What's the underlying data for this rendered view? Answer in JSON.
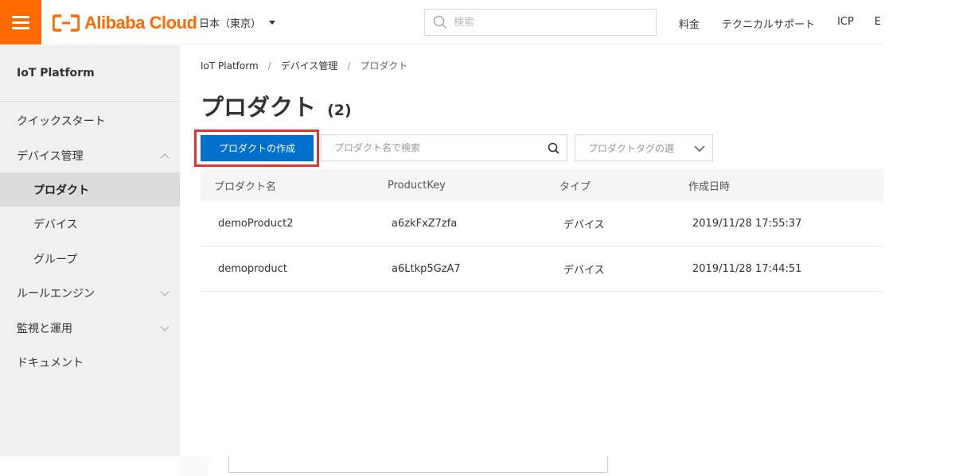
{
  "header": {
    "brand_name": "Alibaba Cloud",
    "brand_color": "#ff6a00",
    "region": "日本（東京）",
    "search_placeholder": "検索",
    "nav": [
      "料金",
      "テクニカルサポート",
      "ICP",
      "E"
    ]
  },
  "sidebar": {
    "title": "IoT Platform",
    "items": [
      {
        "label": "クイックスタート",
        "level": 1,
        "icon": ""
      },
      {
        "label": "デバイス管理",
        "level": 1,
        "icon": "chevron-up-icon"
      },
      {
        "label": "プロダクト",
        "level": 2,
        "active": true
      },
      {
        "label": "デバイス",
        "level": 2
      },
      {
        "label": "グループ",
        "level": 2
      },
      {
        "label": "ルールエンジン",
        "level": 1,
        "icon": "chevron-down-icon"
      },
      {
        "label": "監視と運用",
        "level": 1,
        "icon": "chevron-down-icon"
      },
      {
        "label": "ドキュメント",
        "level": 1,
        "icon": ""
      }
    ]
  },
  "breadcrumb": [
    "IoT Platform",
    "デバイス管理",
    "プロダクト"
  ],
  "page": {
    "title": "プロダクト",
    "count": "(2)"
  },
  "toolbar": {
    "create_button": "プロダクトの作成",
    "create_button_color": "#0070cc",
    "highlight_color": "#e5342f",
    "search_placeholder": "プロダクト名で検索",
    "tag_select_placeholder": "プロダクトタグの選"
  },
  "table": {
    "columns": [
      "プロダクト名",
      "ProductKey",
      "タイプ",
      "作成日時"
    ],
    "rows": [
      [
        "demoProduct2",
        "a6zkFxZ7zfa",
        "デバイス",
        "2019/11/28 17:55:37"
      ],
      [
        "demoproduct",
        "a6Ltkp5GzA7",
        "デバイス",
        "2019/11/28 17:44:51"
      ]
    ]
  }
}
